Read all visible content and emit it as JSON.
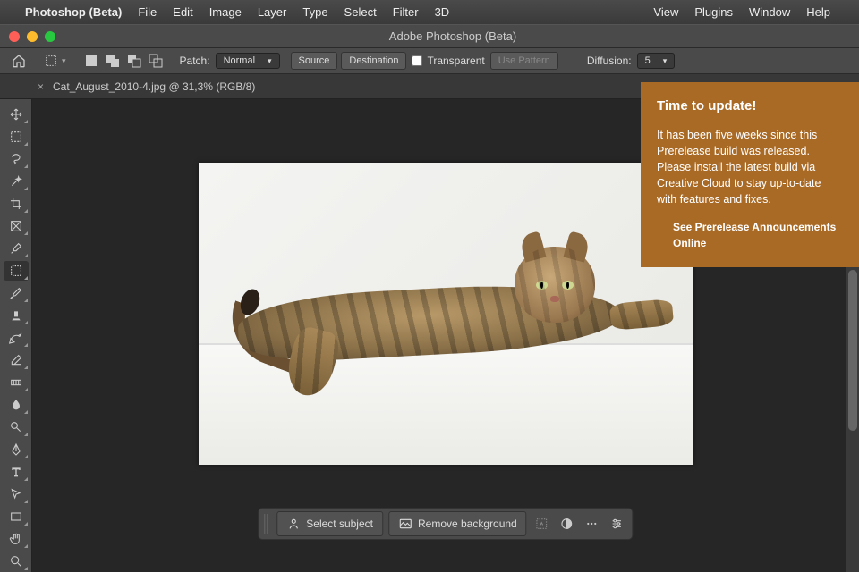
{
  "menubar": {
    "appname": "Photoshop (Beta)",
    "items": [
      "File",
      "Edit",
      "Image",
      "Layer",
      "Type",
      "Select",
      "Filter",
      "3D"
    ],
    "right": [
      "View",
      "Plugins",
      "Window",
      "Help"
    ]
  },
  "window_title": "Adobe Photoshop (Beta)",
  "optbar": {
    "patch_label": "Patch:",
    "patch_value": "Normal",
    "source": "Source",
    "destination": "Destination",
    "transparent": "Transparent",
    "use_pattern": "Use Pattern",
    "diffusion_label": "Diffusion:",
    "diffusion_value": "5"
  },
  "tab": "Cat_August_2010-4.jpg @ 31,3% (RGB/8)",
  "actionbar": {
    "select_subject": "Select subject",
    "remove_bg": "Remove background"
  },
  "notif": {
    "title": "Time to update!",
    "body": "It has been five weeks since this Prerelease build was released. Please install the latest build via Creative Cloud to stay up-to-date with features and fixes.",
    "link": "See Prerelease Announcements Online"
  }
}
